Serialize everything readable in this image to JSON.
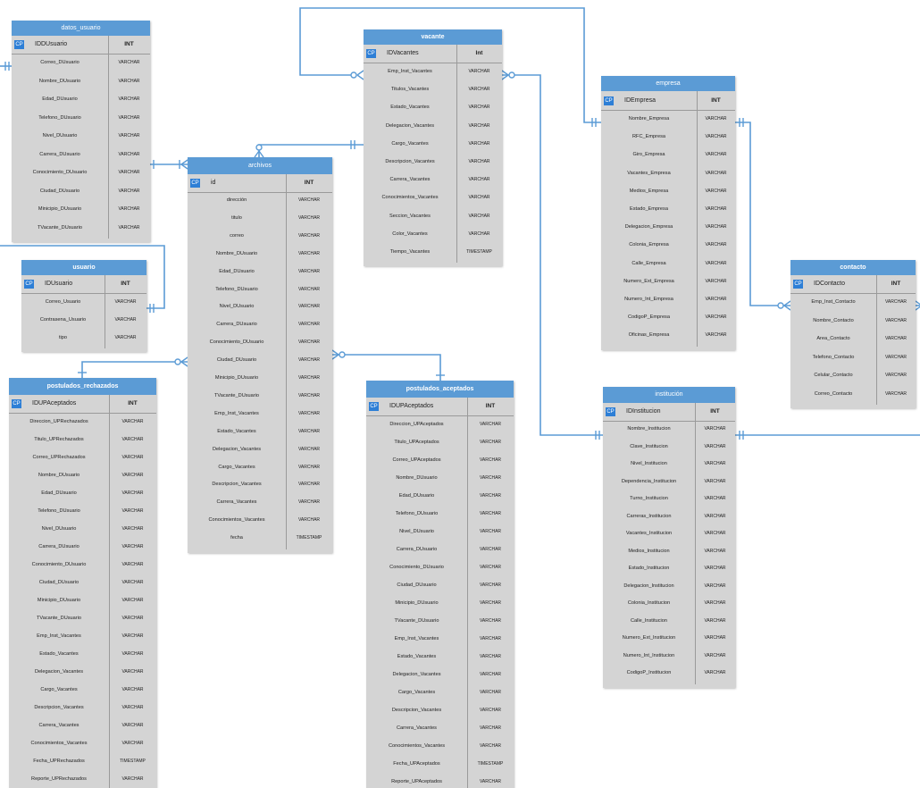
{
  "pk_label": "CP",
  "entities": [
    {
      "id": "datos_usuario",
      "title": "datos_usuario",
      "pk": {
        "name": "IDDUsuario",
        "type": "INT"
      },
      "columns": [
        [
          "Correo_DUsuario",
          "VARCHAR"
        ],
        [
          "Nombre_DUsuario",
          "VARCHAR"
        ],
        [
          "Edad_DUsuario",
          "VARCHAR"
        ],
        [
          "Telefono_DUsuario",
          "VARCHAR"
        ],
        [
          "Nivel_DUsuario",
          "VARCHAR"
        ],
        [
          "Carrera_DUsuario",
          "VARCHAR"
        ],
        [
          "Conocimiento_DUsuario",
          "VARCHAR"
        ],
        [
          "Ciudad_DUsuario",
          "VARCHAR"
        ],
        [
          "Minicipio_DUsuario",
          "VARCHAR"
        ],
        [
          "TVacante_DUsuario",
          "VARCHAR"
        ]
      ]
    },
    {
      "id": "vacante",
      "title": "vacante",
      "pk": {
        "name": "IDVacantes",
        "type": "Int"
      },
      "columns": [
        [
          "Emp_Inst_Vacantes",
          "VARCHAR"
        ],
        [
          "Titulos_Vacantes",
          "VARCHAR"
        ],
        [
          "Estado_Vacantes",
          "VARCHAR"
        ],
        [
          "Delegacion_Vacantes",
          "VARCHAR"
        ],
        [
          "Cargo_Vacantes",
          "VARCHAR"
        ],
        [
          "Descripcion_Vacantes",
          "VARCHAR"
        ],
        [
          "Carrera_Vacantes",
          "VARCHAR"
        ],
        [
          "Conocimientos_Vacantes",
          "VARCHAR"
        ],
        [
          "Seccion_Vacantes",
          "VARCHAR"
        ],
        [
          "Color_Vacantes",
          "VARCHAR"
        ],
        [
          "Tiempo_Vacantes",
          "TIMESTAMP"
        ]
      ]
    },
    {
      "id": "empresa",
      "title": "empresa",
      "pk": {
        "name": "IDEmpresa",
        "type": "INT"
      },
      "columns": [
        [
          "Nombre_Empresa",
          "VARCHAR"
        ],
        [
          "RFC_Empresa",
          "VARCHAR"
        ],
        [
          "Giro_Empresa",
          "VARCHAR"
        ],
        [
          "Vacantes_Empresa",
          "VARCHAR"
        ],
        [
          "Medios_Empresa",
          "VARCHAR"
        ],
        [
          "Estado_Empresa",
          "VARCHAR"
        ],
        [
          "Delegacion_Empresa",
          "VARCHAR"
        ],
        [
          "Colonia_Empresa",
          "VARCHAR"
        ],
        [
          "Calle_Empresa",
          "VARCHAR"
        ],
        [
          "Numero_Ext_Empresa",
          "VARCHAR"
        ],
        [
          "Numero_Int_Empresa",
          "VARCHAR"
        ],
        [
          "CodigoP_Empresa",
          "VARCHAR"
        ],
        [
          "Oficinas_Empresa",
          "VARCHAR"
        ]
      ]
    },
    {
      "id": "archivos",
      "title": "archivos",
      "pk": {
        "name": "id",
        "type": "INT"
      },
      "columns": [
        [
          "dirección",
          "VARCHAR"
        ],
        [
          "titulo",
          "VARCHAR"
        ],
        [
          "correo",
          "VARCHAR"
        ],
        [
          "Nombre_DUsuario",
          "VARCHAR"
        ],
        [
          "Edad_DUsuario",
          "VARCHAR"
        ],
        [
          "Telefono_DUsuario",
          "VARCHAR"
        ],
        [
          "Nivel_DUsuario",
          "VARCHAR"
        ],
        [
          "Carrera_DUsuario",
          "VARCHAR"
        ],
        [
          "Conocimiento_DUsuario",
          "VARCHAR"
        ],
        [
          "Ciudad_DUsuario",
          "VARCHAR"
        ],
        [
          "Minicipio_DUsuario",
          "VARCHAR"
        ],
        [
          "TVacante_DUsuario",
          "VARCHAR"
        ],
        [
          "Emp_Inst_Vacantes",
          "VARCHAR"
        ],
        [
          "Estado_Vacantes",
          "VARCHAR"
        ],
        [
          "Delegacion_Vacantes",
          "VARCHAR"
        ],
        [
          "Cargo_Vacantes",
          "VARCHAR"
        ],
        [
          "Descripcion_Vacantes",
          "VARCHAR"
        ],
        [
          "Carrera_Vacantes",
          "VARCHAR"
        ],
        [
          "Conocimientos_Vacantes",
          "VARCHAR"
        ],
        [
          "fecha",
          "TIMESTAMP"
        ]
      ]
    },
    {
      "id": "usuario",
      "title": "usuario",
      "pk": {
        "name": "IDUsuario",
        "type": "INT"
      },
      "columns": [
        [
          "Correo_Usuario",
          "VARCHAR"
        ],
        [
          "Contrasena_Usuario",
          "VARCHAR"
        ],
        [
          "tipo",
          "VARCHAR"
        ]
      ]
    },
    {
      "id": "contacto",
      "title": "contacto",
      "pk": {
        "name": "IDContacto",
        "type": "INT"
      },
      "columns": [
        [
          "Emp_Inst_Contacto",
          "VARCHAR"
        ],
        [
          "Nombre_Contacto",
          "VARCHAR"
        ],
        [
          "Area_Contacto",
          "VARCHAR"
        ],
        [
          "Telefono_Contacto",
          "VARCHAR"
        ],
        [
          "Celular_Contacto",
          "VARCHAR"
        ],
        [
          "Correo_Contacto",
          "VARCHAR"
        ]
      ]
    },
    {
      "id": "postulados_rechazados",
      "title": "postulados_rechazados",
      "pk": {
        "name": "IDUPAceptados",
        "type": "INT"
      },
      "columns": [
        [
          "Direccion_UPRechazados",
          "VARCHAR"
        ],
        [
          "Titulo_UPRechazados",
          "VARCHAR"
        ],
        [
          "Correo_UPRechazados",
          "VARCHAR"
        ],
        [
          "Nombre_DUsuario",
          "VARCHAR"
        ],
        [
          "Edad_DUsuario",
          "VARCHAR"
        ],
        [
          "Telefono_DUsuario",
          "VARCHAR"
        ],
        [
          "Nivel_DUsuario",
          "VARCHAR"
        ],
        [
          "Carrera_DUsuario",
          "VARCHAR"
        ],
        [
          "Conocimiento_DUsuario",
          "VARCHAR"
        ],
        [
          "Ciudad_DUsuario",
          "VARCHAR"
        ],
        [
          "Minicipio_DUsuario",
          "VARCHAR"
        ],
        [
          "TVacante_DUsuario",
          "VARCHAR"
        ],
        [
          "Emp_Inst_Vacantes",
          "VARCHAR"
        ],
        [
          "Estado_Vacantes",
          "VARCHAR"
        ],
        [
          "Delegacion_Vacantes",
          "VARCHAR"
        ],
        [
          "Cargo_Vacantes",
          "VARCHAR"
        ],
        [
          "Descripcion_Vacantes",
          "VARCHAR"
        ],
        [
          "Carrera_Vacantes",
          "VARCHAR"
        ],
        [
          "Conocimientos_Vacantes",
          "VARCHAR"
        ],
        [
          "Fecha_UPRechazados",
          "TIMESTAMP"
        ],
        [
          "Reporte_UPRechazados",
          "VARCHAR"
        ]
      ]
    },
    {
      "id": "postulados_aceptados",
      "title": "postulados_aceptados",
      "pk": {
        "name": "IDUPAceptados",
        "type": "INT"
      },
      "columns": [
        [
          "Direccion_UPAceptados",
          "VARCHAR"
        ],
        [
          "Titulo_UPAceptados",
          "VARCHAR"
        ],
        [
          "Correo_UPAceptados",
          "VARCHAR"
        ],
        [
          "Nombre_DUsuario",
          "VARCHAR"
        ],
        [
          "Edad_DUsuario",
          "VARCHAR"
        ],
        [
          "Telefono_DUsuario",
          "VARCHAR"
        ],
        [
          "Nivel_DUsuario",
          "VARCHAR"
        ],
        [
          "Carrera_DUsuario",
          "VARCHAR"
        ],
        [
          "Conocimiento_DUsuario",
          "VARCHAR"
        ],
        [
          "Ciudad_DUsuario",
          "VARCHAR"
        ],
        [
          "Minicipio_DUsuario",
          "VARCHAR"
        ],
        [
          "TVacante_DUsuario",
          "VARCHAR"
        ],
        [
          "Emp_Inst_Vacantes",
          "VARCHAR"
        ],
        [
          "Estado_Vacantes",
          "VARCHAR"
        ],
        [
          "Delegacion_Vacantes",
          "VARCHAR"
        ],
        [
          "Cargo_Vacantes",
          "VARCHAR"
        ],
        [
          "Descripcion_Vacantes",
          "VARCHAR"
        ],
        [
          "Carrera_Vacantes",
          "VARCHAR"
        ],
        [
          "Conocimientos_Vacantes",
          "VARCHAR"
        ],
        [
          "Fecha_UPAceptados",
          "TIMESTAMP"
        ],
        [
          "Reporte_UPAceptados",
          "VARCHAR"
        ]
      ]
    },
    {
      "id": "institucion",
      "title": "institución",
      "pk": {
        "name": "IDInstitucion",
        "type": "INT"
      },
      "columns": [
        [
          "Nombre_Institucion",
          "VARCHAR"
        ],
        [
          "Clave_Institucion",
          "VARCHAR"
        ],
        [
          "Nivel_Institucion",
          "VARCHAR"
        ],
        [
          "Dependencia_Institucion",
          "VARCHAR"
        ],
        [
          "Turno_Institucion",
          "VARCHAR"
        ],
        [
          "Carreras_Institucion",
          "VARCHAR"
        ],
        [
          "Vacantes_Institucion",
          "VARCHAR"
        ],
        [
          "Medios_Institucion",
          "VARCHAR"
        ],
        [
          "Estado_Institucion",
          "VARCHAR"
        ],
        [
          "Delegacion_Institucion",
          "VARCHAR"
        ],
        [
          "Colonia_Institucion",
          "VARCHAR"
        ],
        [
          "Calle_Institucion",
          "VARCHAR"
        ],
        [
          "Numero_Ext_Institucion",
          "VARCHAR"
        ],
        [
          "Numero_Int_Institucion",
          "VARCHAR"
        ],
        [
          "CodigoP_Institucion",
          "VARCHAR"
        ]
      ]
    }
  ],
  "colors": {
    "header": "#5b9bd5",
    "body": "#d4d4d4",
    "connector": "#5b9bd5",
    "pk_badge": "#2e7fd6"
  }
}
